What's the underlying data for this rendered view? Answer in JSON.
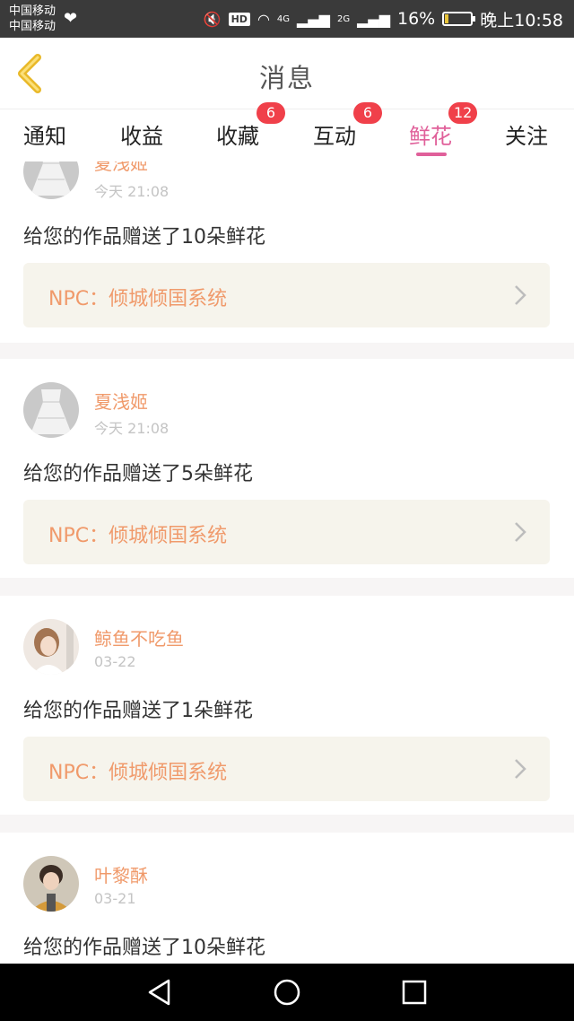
{
  "status_bar": {
    "carrier_1": "中国移动",
    "carrier_2": "中国移动",
    "hd": "HD",
    "net_1": "4G",
    "net_2": "2G",
    "battery": "16%",
    "battery_level": 0.16,
    "time": "晚上10:58"
  },
  "header": {
    "title": "消息"
  },
  "tabs": [
    {
      "label": "通知",
      "badge": ""
    },
    {
      "label": "收益",
      "badge": ""
    },
    {
      "label": "收藏",
      "badge": "6"
    },
    {
      "label": "互动",
      "badge": "6"
    },
    {
      "label": "鲜花",
      "badge": "12",
      "active": true
    },
    {
      "label": "关注",
      "badge": ""
    }
  ],
  "messages": [
    {
      "user": "夏浅姬",
      "time": "今天 21:08",
      "text": "给您的作品赠送了10朵鲜花",
      "npc": "NPC：倾城倾国系统",
      "avatar": "dress"
    },
    {
      "user": "夏浅姬",
      "time": "今天 21:08",
      "text": "给您的作品赠送了5朵鲜花",
      "npc": "NPC：倾城倾国系统",
      "avatar": "dress"
    },
    {
      "user": "鲸鱼不吃鱼",
      "time": "03-22",
      "text": "给您的作品赠送了1朵鲜花",
      "npc": "NPC：倾城倾国系统",
      "avatar": "girl"
    },
    {
      "user": "叶黎酥",
      "time": "03-21",
      "text": "给您的作品赠送了10朵鲜花",
      "npc": "",
      "avatar": "boy"
    }
  ],
  "colors": {
    "accent_pink": "#e0609a",
    "username_orange": "#f09a6b",
    "badge_red": "#f0404a",
    "back_arrow_yellow": "#f2c230"
  }
}
